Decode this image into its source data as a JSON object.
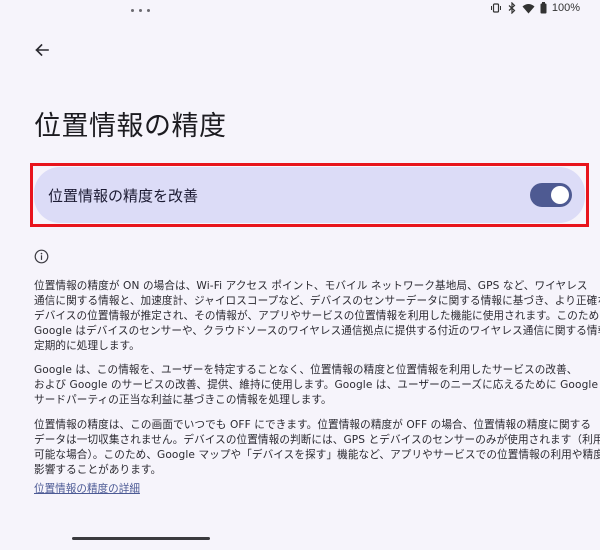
{
  "status_bar": {
    "battery_text": "100%",
    "icons": [
      "vibrate-icon",
      "bluetooth-icon",
      "wifi-icon",
      "battery-icon"
    ]
  },
  "header": {
    "back_icon": "arrow-left-icon",
    "title": "位置情報の精度"
  },
  "toggle": {
    "label": "位置情報の精度を改善",
    "state": "on",
    "track_color": "#4e5a92"
  },
  "info": {
    "icon": "info-icon",
    "paragraph1": [
      "位置情報の精度が ON の場合は、Wi-Fi アクセス ポイント、モバイル ネットワーク基地局、GPS など、ワイヤレス",
      "通信に関する情報と、加速度計、ジャイロスコープなど、デバイスのセンサーデータに関する情報に基づき、より正確な",
      "デバイスの位置情報が推定され、その情報が、アプリやサービスの位置情報を利用した機能に使用されます。このために、",
      "Google はデバイスのセンサーや、クラウドソースのワイヤレス通信拠点に提供する付近のワイヤレス通信に関する情報を",
      "定期的に処理します。"
    ],
    "paragraph2": [
      "Google は、この情報を、ユーザーを特定することなく、位置情報の精度と位置情報を利用したサービスの改善、",
      "および Google のサービスの改善、提供、維持に使用します。Google は、ユーザーのニーズに応えるために Google と",
      "サードパーティの正当な利益に基づきこの情報を処理します。"
    ],
    "paragraph3": [
      "位置情報の精度は、この画面でいつでも OFF にできます。位置情報の精度が OFF の場合、位置情報の精度に関する",
      "データは一切収集されません。デバイスの位置情報の判断には、GPS とデバイスのセンサーのみが使用されます（利用",
      "可能な場合）。このため、Google マップや「デバイスを探す」機能など、アプリやサービスでの位置情報の利用や精度に",
      "影響することがあります。"
    ],
    "link": "位置情報の精度の詳細"
  },
  "colors": {
    "background": "#f6f4fb",
    "card": "#dcdcf7",
    "highlight": "#e8141c",
    "link": "#4c5a95"
  }
}
